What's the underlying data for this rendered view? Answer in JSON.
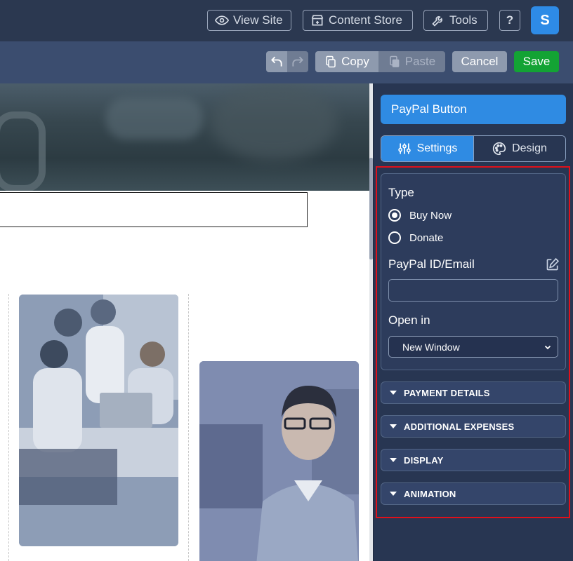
{
  "topbar": {
    "view_site": "View Site",
    "content_store": "Content Store",
    "tools": "Tools",
    "help": "?",
    "avatar_initial": "S"
  },
  "toolbar": {
    "copy": "Copy",
    "paste": "Paste",
    "cancel": "Cancel",
    "save": "Save"
  },
  "panel": {
    "title": "PayPal Button",
    "tabs": {
      "settings": "Settings",
      "design": "Design"
    },
    "type_label": "Type",
    "type_options": [
      "Buy Now",
      "Donate"
    ],
    "type_selected": "Buy Now",
    "email_label": "PayPal ID/Email",
    "email_value": "",
    "open_in_label": "Open in",
    "open_in_value": "New Window",
    "sections": [
      "PAYMENT DETAILS",
      "ADDITIONAL EXPENSES",
      "DISPLAY",
      "ANIMATION"
    ]
  },
  "colors": {
    "topbar_bg": "#2b3850",
    "toolbar_bg": "#3b4d6f",
    "panel_bg": "#283652",
    "accent_blue": "#2f8be3",
    "save_green": "#13a334",
    "highlight_red": "#e0101a"
  },
  "icons": [
    "eye-icon",
    "store-icon",
    "wrench-icon",
    "undo-icon",
    "redo-icon",
    "copy-icon",
    "paste-icon",
    "sliders-icon",
    "palette-icon",
    "edit-icon",
    "caret-down-icon"
  ]
}
